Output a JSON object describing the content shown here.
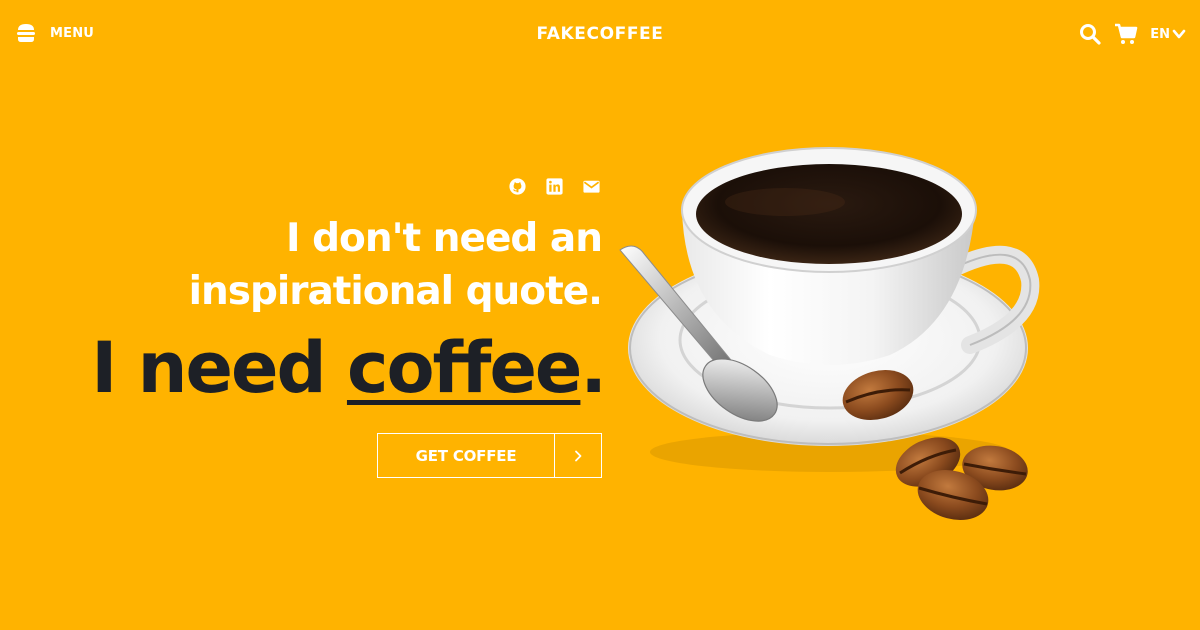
{
  "nav": {
    "menu_label": "MENU",
    "brand": "FAKECOFFEE",
    "language": "EN",
    "icons": [
      "burger-icon",
      "search-icon",
      "cart-icon",
      "chevron-down-icon"
    ]
  },
  "hero": {
    "social_icons": [
      "github-icon",
      "linkedin-icon",
      "mail-icon"
    ],
    "quote_line1": "I don't need an",
    "quote_line2": "inspirational quote.",
    "headline_pre": "I need ",
    "headline_word": "coffee",
    "headline_post": ".",
    "cta_label": "GET COFFEE",
    "cta_icon": "chevron-right-icon"
  },
  "colors": {
    "background": "#FFB300",
    "headline": "#1D2026",
    "text": "#FFFFFF"
  }
}
